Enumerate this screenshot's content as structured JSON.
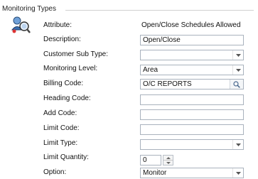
{
  "group": {
    "title": "Monitoring Types"
  },
  "fields": {
    "attribute": {
      "label": "Attribute:",
      "value": "Open/Close Schedules Allowed"
    },
    "description": {
      "label": "Description:",
      "value": "Open/Close"
    },
    "customer_sub_type": {
      "label": "Customer Sub Type:",
      "value": ""
    },
    "monitoring_level": {
      "label": "Monitoring Level:",
      "value": "Area"
    },
    "billing_code": {
      "label": "Billing Code:",
      "value": "O/C REPORTS"
    },
    "heading_code": {
      "label": "Heading Code:",
      "value": ""
    },
    "add_code": {
      "label": "Add Code:",
      "value": ""
    },
    "limit_code": {
      "label": "Limit Code:",
      "value": ""
    },
    "limit_type": {
      "label": "Limit Type:",
      "value": ""
    },
    "limit_quantity": {
      "label": "Limit Quantity:",
      "value": "0"
    },
    "option": {
      "label": "Option:",
      "value": "Monitor"
    }
  },
  "icons": {
    "app": "monitoring-types-icon",
    "dropdown": "chevron-down-icon",
    "lookup": "search-icon",
    "spin_up": "spin-up-icon",
    "spin_down": "spin-down-icon"
  },
  "colors": {
    "border": "#a9b2bd",
    "group_line": "#d0d0d0"
  }
}
